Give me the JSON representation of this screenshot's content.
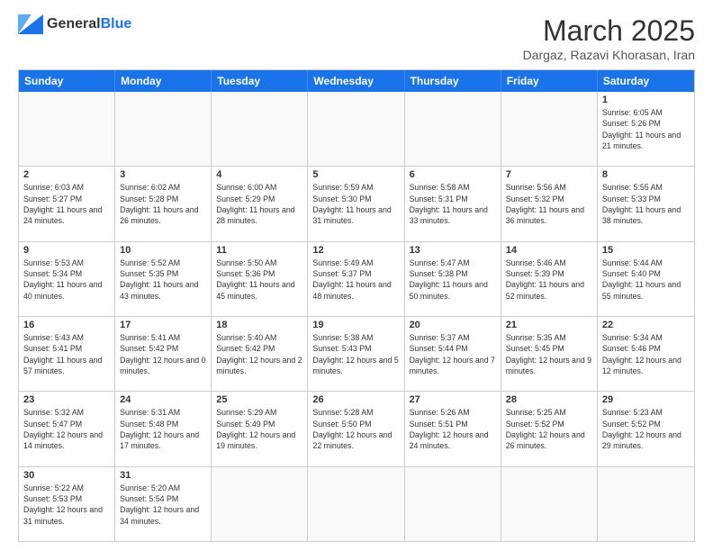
{
  "header": {
    "logo_general": "General",
    "logo_blue": "Blue",
    "month_title": "March 2025",
    "location": "Dargaz, Razavi Khorasan, Iran"
  },
  "days_of_week": [
    "Sunday",
    "Monday",
    "Tuesday",
    "Wednesday",
    "Thursday",
    "Friday",
    "Saturday"
  ],
  "weeks": [
    [
      {
        "day": "",
        "info": ""
      },
      {
        "day": "",
        "info": ""
      },
      {
        "day": "",
        "info": ""
      },
      {
        "day": "",
        "info": ""
      },
      {
        "day": "",
        "info": ""
      },
      {
        "day": "",
        "info": ""
      },
      {
        "day": "1",
        "info": "Sunrise: 6:05 AM\nSunset: 5:26 PM\nDaylight: 11 hours and 21 minutes."
      }
    ],
    [
      {
        "day": "2",
        "info": "Sunrise: 6:03 AM\nSunset: 5:27 PM\nDaylight: 11 hours and 24 minutes."
      },
      {
        "day": "3",
        "info": "Sunrise: 6:02 AM\nSunset: 5:28 PM\nDaylight: 11 hours and 26 minutes."
      },
      {
        "day": "4",
        "info": "Sunrise: 6:00 AM\nSunset: 5:29 PM\nDaylight: 11 hours and 28 minutes."
      },
      {
        "day": "5",
        "info": "Sunrise: 5:59 AM\nSunset: 5:30 PM\nDaylight: 11 hours and 31 minutes."
      },
      {
        "day": "6",
        "info": "Sunrise: 5:58 AM\nSunset: 5:31 PM\nDaylight: 11 hours and 33 minutes."
      },
      {
        "day": "7",
        "info": "Sunrise: 5:56 AM\nSunset: 5:32 PM\nDaylight: 11 hours and 36 minutes."
      },
      {
        "day": "8",
        "info": "Sunrise: 5:55 AM\nSunset: 5:33 PM\nDaylight: 11 hours and 38 minutes."
      }
    ],
    [
      {
        "day": "9",
        "info": "Sunrise: 5:53 AM\nSunset: 5:34 PM\nDaylight: 11 hours and 40 minutes."
      },
      {
        "day": "10",
        "info": "Sunrise: 5:52 AM\nSunset: 5:35 PM\nDaylight: 11 hours and 43 minutes."
      },
      {
        "day": "11",
        "info": "Sunrise: 5:50 AM\nSunset: 5:36 PM\nDaylight: 11 hours and 45 minutes."
      },
      {
        "day": "12",
        "info": "Sunrise: 5:49 AM\nSunset: 5:37 PM\nDaylight: 11 hours and 48 minutes."
      },
      {
        "day": "13",
        "info": "Sunrise: 5:47 AM\nSunset: 5:38 PM\nDaylight: 11 hours and 50 minutes."
      },
      {
        "day": "14",
        "info": "Sunrise: 5:46 AM\nSunset: 5:39 PM\nDaylight: 11 hours and 52 minutes."
      },
      {
        "day": "15",
        "info": "Sunrise: 5:44 AM\nSunset: 5:40 PM\nDaylight: 11 hours and 55 minutes."
      }
    ],
    [
      {
        "day": "16",
        "info": "Sunrise: 5:43 AM\nSunset: 5:41 PM\nDaylight: 11 hours and 57 minutes."
      },
      {
        "day": "17",
        "info": "Sunrise: 5:41 AM\nSunset: 5:42 PM\nDaylight: 12 hours and 0 minutes."
      },
      {
        "day": "18",
        "info": "Sunrise: 5:40 AM\nSunset: 5:42 PM\nDaylight: 12 hours and 2 minutes."
      },
      {
        "day": "19",
        "info": "Sunrise: 5:38 AM\nSunset: 5:43 PM\nDaylight: 12 hours and 5 minutes."
      },
      {
        "day": "20",
        "info": "Sunrise: 5:37 AM\nSunset: 5:44 PM\nDaylight: 12 hours and 7 minutes."
      },
      {
        "day": "21",
        "info": "Sunrise: 5:35 AM\nSunset: 5:45 PM\nDaylight: 12 hours and 9 minutes."
      },
      {
        "day": "22",
        "info": "Sunrise: 5:34 AM\nSunset: 5:46 PM\nDaylight: 12 hours and 12 minutes."
      }
    ],
    [
      {
        "day": "23",
        "info": "Sunrise: 5:32 AM\nSunset: 5:47 PM\nDaylight: 12 hours and 14 minutes."
      },
      {
        "day": "24",
        "info": "Sunrise: 5:31 AM\nSunset: 5:48 PM\nDaylight: 12 hours and 17 minutes."
      },
      {
        "day": "25",
        "info": "Sunrise: 5:29 AM\nSunset: 5:49 PM\nDaylight: 12 hours and 19 minutes."
      },
      {
        "day": "26",
        "info": "Sunrise: 5:28 AM\nSunset: 5:50 PM\nDaylight: 12 hours and 22 minutes."
      },
      {
        "day": "27",
        "info": "Sunrise: 5:26 AM\nSunset: 5:51 PM\nDaylight: 12 hours and 24 minutes."
      },
      {
        "day": "28",
        "info": "Sunrise: 5:25 AM\nSunset: 5:52 PM\nDaylight: 12 hours and 26 minutes."
      },
      {
        "day": "29",
        "info": "Sunrise: 5:23 AM\nSunset: 5:52 PM\nDaylight: 12 hours and 29 minutes."
      }
    ],
    [
      {
        "day": "30",
        "info": "Sunrise: 5:22 AM\nSunset: 5:53 PM\nDaylight: 12 hours and 31 minutes."
      },
      {
        "day": "31",
        "info": "Sunrise: 5:20 AM\nSunset: 5:54 PM\nDaylight: 12 hours and 34 minutes."
      },
      {
        "day": "",
        "info": ""
      },
      {
        "day": "",
        "info": ""
      },
      {
        "day": "",
        "info": ""
      },
      {
        "day": "",
        "info": ""
      },
      {
        "day": "",
        "info": ""
      }
    ]
  ]
}
